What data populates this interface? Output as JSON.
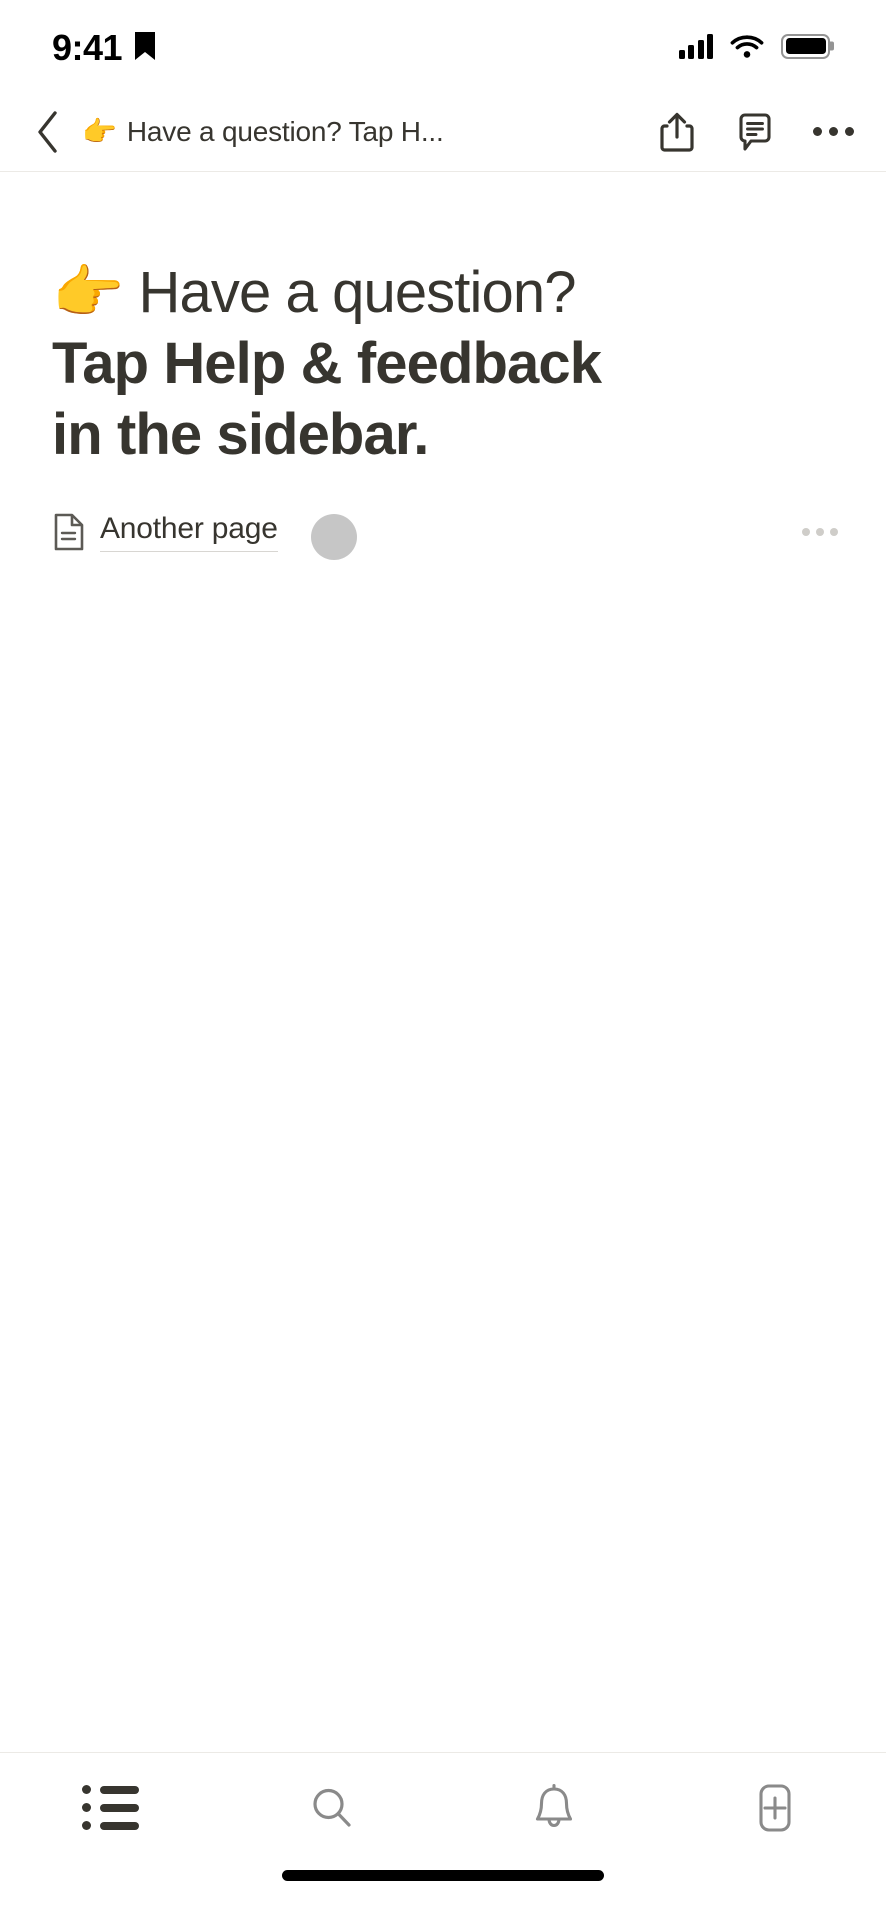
{
  "status_bar": {
    "time": "9:41",
    "bookmark_icon": "bookmark-icon",
    "cellular_icon": "cellular-signal-icon",
    "cellular_bars": 4,
    "wifi_icon": "wifi-icon",
    "battery_icon": "battery-icon",
    "battery_level": 100
  },
  "nav_bar": {
    "back_icon": "chevron-left-icon",
    "emoji": "👉",
    "title": "Have a question? Tap H...",
    "share_icon": "share-icon",
    "comment_icon": "comment-icon",
    "more_icon": "more-options-icon"
  },
  "page": {
    "title_emoji": "👉",
    "title": "Have a question? Tap Help & feedback in the sidebar.",
    "title_lines": [
      "👉 Have a question?",
      "Tap Help & feedback",
      "in the sidebar."
    ],
    "blocks": [
      {
        "type": "page-link",
        "icon": "page-document-icon",
        "label": "Another page",
        "more_icon": "block-more-icon"
      }
    ]
  },
  "tab_bar": {
    "items": [
      {
        "name": "home-list-tab",
        "icon": "list-icon",
        "active": true
      },
      {
        "name": "search-tab",
        "icon": "search-icon",
        "active": false
      },
      {
        "name": "notifications-tab",
        "icon": "bell-icon",
        "active": false
      },
      {
        "name": "new-page-tab",
        "icon": "new-page-plus-icon",
        "active": false
      }
    ]
  },
  "overlays": {
    "touch_indicator": "touch-indicator"
  },
  "colors": {
    "text_primary": "#37352f",
    "text_muted": "#8a8a8a",
    "divider": "#eceae6",
    "underline": "#d8d6d2",
    "background": "#ffffff",
    "touch_indicator": "rgba(120,120,120,0.42)"
  },
  "home_indicator": "home-indicator"
}
